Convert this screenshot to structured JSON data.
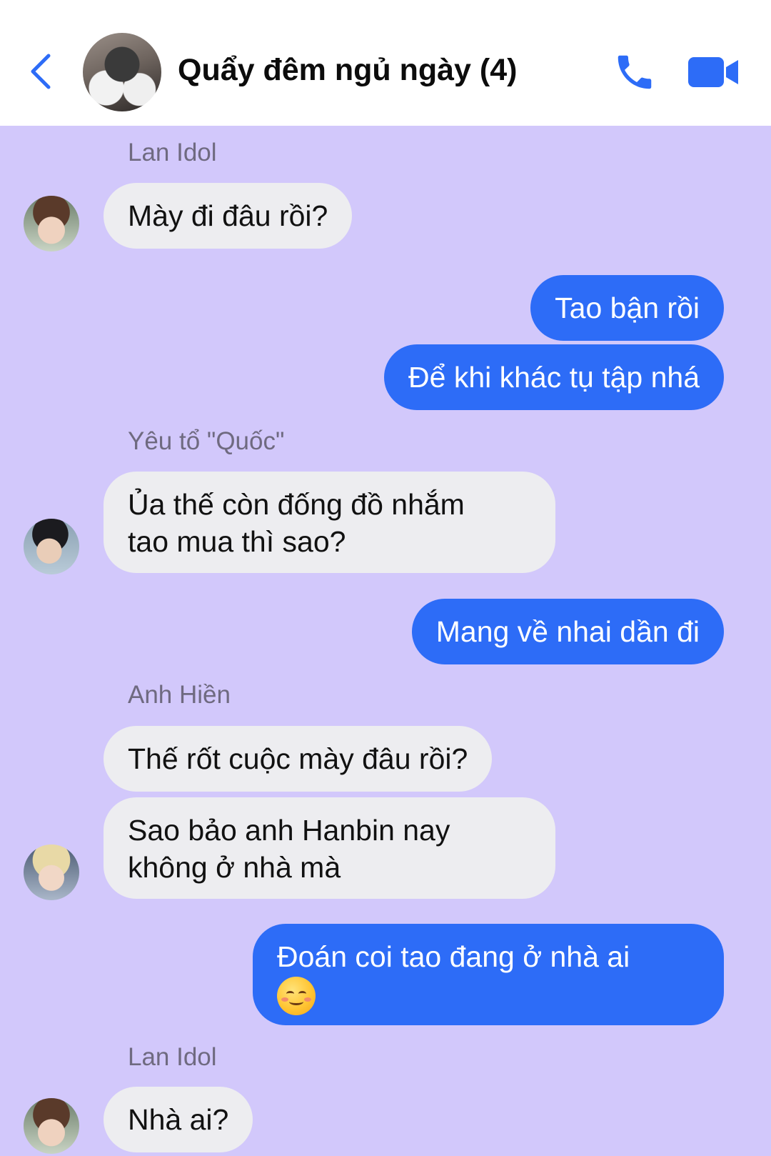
{
  "header": {
    "title": "Quẩy đêm ngủ ngày (4)",
    "back_icon": "chevron-left-icon",
    "call_icon": "phone-icon",
    "video_icon": "video-camera-icon",
    "accent_color": "#2d6cf7"
  },
  "theme": {
    "background": "#d2c8fb",
    "incoming_bubble": "#ededf0",
    "outgoing_bubble": "#2d6cf7"
  },
  "messages": [
    {
      "sender": "Lan Idol",
      "text": "Mày đi đâu rồi?"
    },
    {
      "outgoing": true,
      "text": "Tao bận rồi"
    },
    {
      "outgoing": true,
      "text": "Để khi khác tụ tập nhá"
    },
    {
      "sender": "Yêu tổ \"Quốc\"",
      "line1": "Ủa thế còn đống đồ nhắm",
      "line2": "tao mua thì sao?"
    },
    {
      "outgoing": true,
      "text": "Mang về nhai dần đi"
    },
    {
      "sender": "Anh Hiền",
      "text": "Thế rốt cuộc mày đâu rồi?"
    },
    {
      "line1": "Sao bảo anh Hanbin nay",
      "line2": "không ở nhà mà"
    },
    {
      "outgoing": true,
      "text": "Đoán coi tao đang ở nhà ai",
      "emoji": "smiling-face-icon"
    },
    {
      "sender": "Lan Idol",
      "text": "Nhà ai?"
    }
  ]
}
